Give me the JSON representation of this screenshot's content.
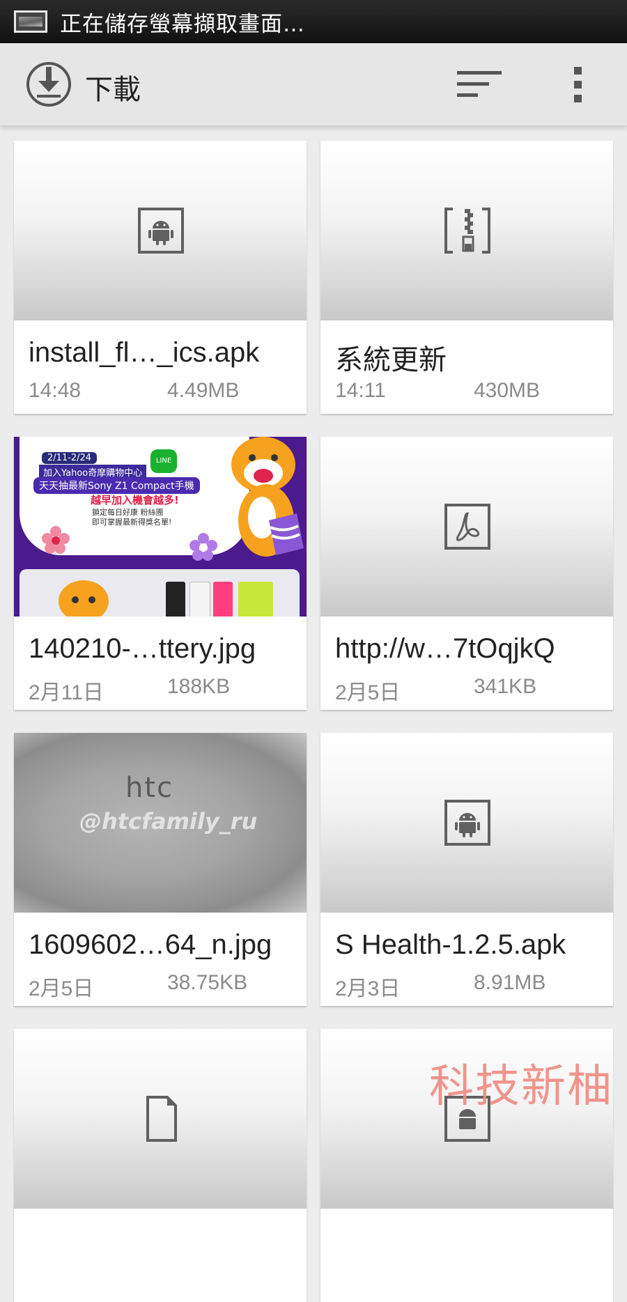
{
  "status_bar": {
    "text": "正在儲存螢幕擷取畫面…"
  },
  "action_bar": {
    "title": "下載"
  },
  "files": [
    {
      "name": "install_fl…_ics.apk",
      "date": "14:48",
      "size": "4.49MB",
      "type_icon": "android-icon"
    },
    {
      "name": "系統更新",
      "date": "14:11",
      "size": "430MB",
      "type_icon": "zip-icon"
    },
    {
      "name": "140210-…ttery.jpg",
      "date": "2月11日",
      "size": "188KB",
      "type_icon": "image-thumbnail"
    },
    {
      "name": "http://w…7tOqjkQ",
      "date": "2月5日",
      "size": "341KB",
      "type_icon": "pdf-icon"
    },
    {
      "name": "1609602…64_n.jpg",
      "date": "2月5日",
      "size": "38.75KB",
      "type_icon": "image-thumbnail"
    },
    {
      "name": "S Health-1.2.5.apk",
      "date": "2月3日",
      "size": "8.91MB",
      "type_icon": "android-icon"
    },
    {
      "name": "",
      "date": "",
      "size": "",
      "type_icon": "document-icon"
    },
    {
      "name": "",
      "date": "",
      "size": "",
      "type_icon": "android-icon"
    }
  ],
  "promo_image": {
    "line1": "2/11-2/24",
    "line2": "加入Yahoo奇摩購物中心",
    "line_badge": "LINE",
    "line3": "天天抽最新Sony Z1 Compact手機",
    "line4": "越早加入機會越多!",
    "line5": "鎖定每日好康 粉絲團",
    "line6": "即可掌握最新得獎名單!"
  },
  "htc_image": {
    "logo": "htc",
    "watermark": "@htcfamily_ru"
  },
  "watermark": "科技新柚",
  "colors": {
    "status_bar": "#1a1a1a",
    "action_bar": "#e6e6e6",
    "background": "#ececec",
    "icon_gray": "#606060",
    "watermark": "#f08a80"
  }
}
